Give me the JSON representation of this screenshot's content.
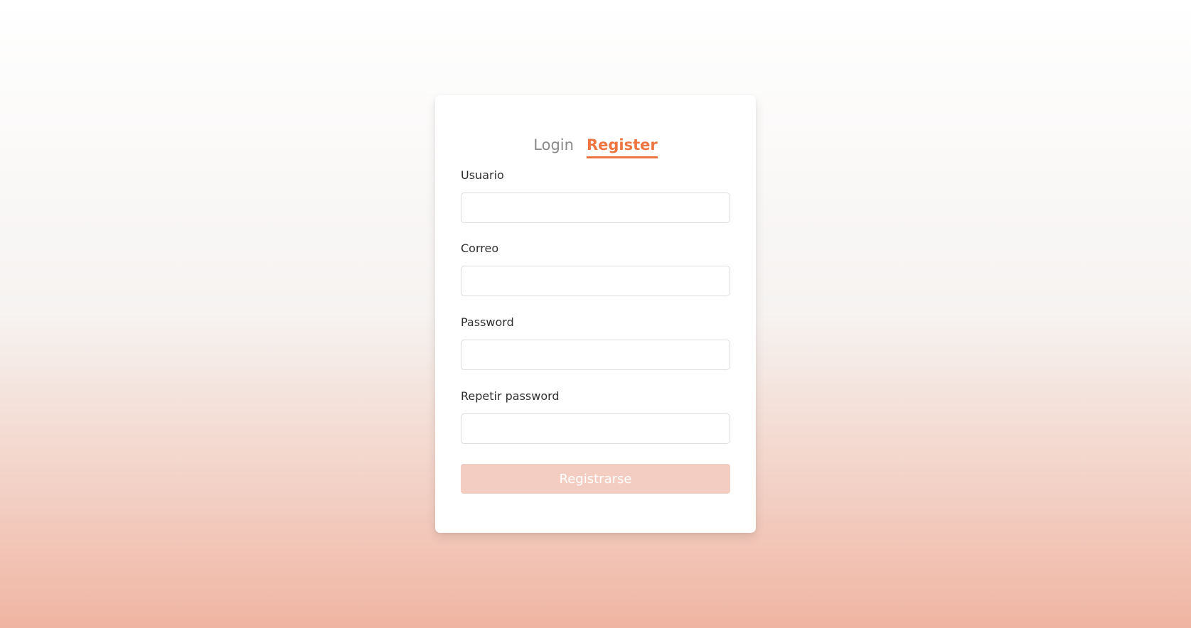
{
  "tabs": {
    "login": "Login",
    "register": "Register"
  },
  "form": {
    "fields": [
      {
        "label": "Usuario",
        "value": "",
        "placeholder": ""
      },
      {
        "label": "Correo",
        "value": "",
        "placeholder": ""
      },
      {
        "label": "Password",
        "value": "",
        "placeholder": ""
      },
      {
        "label": "Repetir password",
        "value": "",
        "placeholder": ""
      }
    ],
    "submit_label": "Registrarse"
  },
  "colors": {
    "accent": "#ee7440",
    "button_disabled": "#f4cdc2",
    "background_top": "#ffffff",
    "background_bottom": "#f0b5a2"
  }
}
